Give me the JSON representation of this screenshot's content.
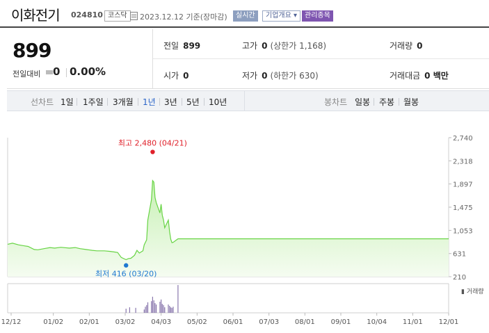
{
  "header": {
    "name": "이화전기",
    "code": "024810",
    "market": "코스닥",
    "date_text": "2023.12.12 기준(장마감)",
    "realtime_label": "실시간",
    "company_label": "기업개요",
    "managed_label": "관리종목"
  },
  "quote": {
    "current_price": "899",
    "change_label": "전일대비",
    "change_value": "0",
    "change_pct": "0.00%"
  },
  "stats": {
    "prev_close_label": "전일",
    "prev_close": "899",
    "high_label": "고가",
    "high": "0",
    "high_limit": "(상한가 1,168)",
    "volume_label": "거래량",
    "volume": "0",
    "open_label": "시가",
    "open": "0",
    "low_label": "저가",
    "low": "0",
    "low_limit": "(하한가 630)",
    "amount_label": "거래대금",
    "amount": "0 백만"
  },
  "toolbar": {
    "line_label": "선차트",
    "periods": [
      "1일",
      "1주일",
      "3개월",
      "1년",
      "3년",
      "5년",
      "10년"
    ],
    "active_period": "1년",
    "candle_label": "봉차트",
    "candles": [
      "일봉",
      "주봉",
      "월봉"
    ]
  },
  "colors": {
    "line": "#67d444",
    "area_top": "#c7f0b4",
    "area_bottom": "#f5fcf1",
    "high_marker": "#e0202a",
    "low_marker": "#1f78d1",
    "volume_bar": "#8977ad",
    "active_tab": "#2a64c8"
  },
  "chart_data": {
    "type": "area",
    "period": "1년",
    "y_ticks": [
      "2,740",
      "2,318",
      "1,897",
      "1,475",
      "1,053",
      "631",
      "210"
    ],
    "ylim": [
      210,
      2740
    ],
    "x_ticks": [
      "12/12",
      "01/02",
      "02/01",
      "03/02",
      "04/03",
      "05/02",
      "06/01",
      "07/03",
      "08/01",
      "09/01",
      "10/04",
      "11/01",
      "12/01"
    ],
    "high_annotation": "최고 2,480 (04/21)",
    "low_annotation": "최저 416 (03/20)",
    "volume_label": "거래량",
    "series": [
      {
        "points": [
          [
            "2022-12-12",
            800
          ],
          [
            "2022-12-16",
            820
          ],
          [
            "2022-12-21",
            790
          ],
          [
            "2022-12-26",
            770
          ],
          [
            "2022-12-29",
            760
          ],
          [
            "2023-01-03",
            705
          ],
          [
            "2023-01-06",
            700
          ],
          [
            "2023-01-11",
            720
          ],
          [
            "2023-01-16",
            740
          ],
          [
            "2023-01-20",
            730
          ],
          [
            "2023-01-25",
            745
          ],
          [
            "2023-02-01",
            730
          ],
          [
            "2023-02-06",
            740
          ],
          [
            "2023-02-10",
            720
          ],
          [
            "2023-02-15",
            705
          ],
          [
            "2023-02-20",
            690
          ],
          [
            "2023-02-24",
            680
          ],
          [
            "2023-03-02",
            680
          ],
          [
            "2023-03-07",
            670
          ],
          [
            "2023-03-10",
            660
          ],
          [
            "2023-03-13",
            650
          ],
          [
            "2023-03-16",
            560
          ],
          [
            "2023-03-20",
            520
          ],
          [
            "2023-03-22",
            540
          ],
          [
            "2023-03-24",
            545
          ],
          [
            "2023-03-27",
            600
          ],
          [
            "2023-03-29",
            690
          ],
          [
            "2023-03-31",
            640
          ],
          [
            "2023-04-03",
            680
          ],
          [
            "2023-04-04",
            790
          ],
          [
            "2023-04-06",
            880
          ],
          [
            "2023-04-07",
            1240
          ],
          [
            "2023-04-10",
            1610
          ],
          [
            "2023-04-11",
            1960
          ],
          [
            "2023-04-12",
            1930
          ],
          [
            "2023-04-13",
            1650
          ],
          [
            "2023-04-14",
            1560
          ],
          [
            "2023-04-17",
            1370
          ],
          [
            "2023-04-18",
            1530
          ],
          [
            "2023-04-19",
            1330
          ],
          [
            "2023-04-20",
            1240
          ],
          [
            "2023-04-21",
            1100
          ],
          [
            "2023-04-24",
            1240
          ],
          [
            "2023-04-25",
            1030
          ],
          [
            "2023-04-26",
            890
          ],
          [
            "2023-04-27",
            830
          ],
          [
            "2023-04-28",
            835
          ],
          [
            "2023-05-02",
            899
          ],
          [
            "2023-12-12",
            899
          ]
        ]
      }
    ],
    "volume": [
      [
        "2023-03-20",
        0.15
      ],
      [
        "2023-03-23",
        0.2
      ],
      [
        "2023-03-28",
        0.18
      ],
      [
        "2023-04-04",
        0.12
      ],
      [
        "2023-04-05",
        0.22
      ],
      [
        "2023-04-06",
        0.28
      ],
      [
        "2023-04-07",
        0.38
      ],
      [
        "2023-04-10",
        0.42
      ],
      [
        "2023-04-11",
        0.58
      ],
      [
        "2023-04-12",
        0.45
      ],
      [
        "2023-04-13",
        0.35
      ],
      [
        "2023-04-14",
        0.3
      ],
      [
        "2023-04-17",
        0.4
      ],
      [
        "2023-04-18",
        0.48
      ],
      [
        "2023-04-19",
        0.32
      ],
      [
        "2023-04-20",
        0.28
      ],
      [
        "2023-04-21",
        0.2
      ],
      [
        "2023-04-24",
        0.3
      ],
      [
        "2023-04-25",
        0.25
      ],
      [
        "2023-04-26",
        0.2
      ],
      [
        "2023-04-27",
        0.18
      ],
      [
        "2023-04-28",
        0.22
      ],
      [
        "2023-05-02",
        1.0
      ]
    ]
  }
}
